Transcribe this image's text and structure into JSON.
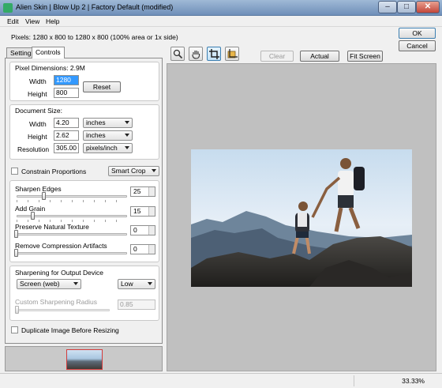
{
  "window": {
    "title": "Alien Skin | Blow Up 2 | Factory Default (modified)",
    "minimize": "–",
    "maximize": "□",
    "close": "✕"
  },
  "menu": [
    "Edit",
    "View",
    "Help"
  ],
  "pixels_info": "Pixels: 1280 x 800 to 1280 x 800 (100% area or 1x side)",
  "dialog": {
    "ok": "OK",
    "cancel": "Cancel"
  },
  "tabs": [
    "Settings",
    "Controls"
  ],
  "pixel_dimensions": {
    "title": "Pixel Dimensions: 2.9M",
    "width_label": "Width",
    "width": "1280",
    "height_label": "Height",
    "height": "800",
    "reset": "Reset"
  },
  "document_size": {
    "title": "Document Size:",
    "width_label": "Width",
    "width": "4.20",
    "width_unit": "inches",
    "height_label": "Height",
    "height": "2.62",
    "height_unit": "inches",
    "resolution_label": "Resolution",
    "resolution": "305.00",
    "resolution_unit": "pixels/inch"
  },
  "constrain": {
    "label": "Constrain Proportions",
    "checked": false,
    "mode": "Smart Crop"
  },
  "sliders": [
    {
      "label": "Sharpen Edges",
      "value": "25",
      "level": 0.25
    },
    {
      "label": "Add Grain",
      "value": "15",
      "level": 0.15
    },
    {
      "label": "Preserve Natural Texture",
      "value": "0",
      "level": 0
    },
    {
      "label": "Remove Compression Artifacts",
      "value": "0",
      "level": 0
    }
  ],
  "output": {
    "title": "Sharpening for Output Device",
    "device": "Screen (web)",
    "strength": "Low",
    "custom_label": "Custom Sharpening Radius",
    "custom_value": "0.85"
  },
  "duplicate": {
    "label": "Duplicate Image Before Resizing",
    "checked": false
  },
  "toolbar": {
    "tools": [
      "zoom-icon",
      "hand-icon",
      "crop-icon",
      "crop-selection-icon"
    ],
    "clear_crop": "Clear Crop",
    "actual_pixels": "Actual Pixels",
    "fit_screen": "Fit Screen"
  },
  "status": {
    "zoom": "33.33%"
  }
}
